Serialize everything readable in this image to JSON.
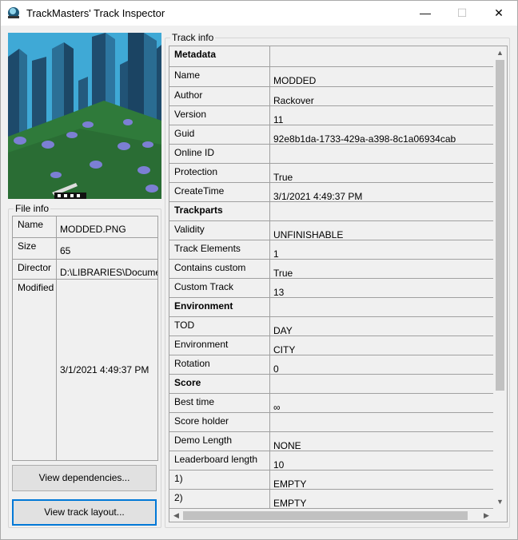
{
  "window": {
    "title": "TrackMasters' Track Inspector",
    "minimize_glyph": "—",
    "maximize_glyph": "☐",
    "close_glyph": "✕"
  },
  "file_info": {
    "label": "File info",
    "rows": [
      {
        "key": "Name",
        "value": "MODDED.PNG"
      },
      {
        "key": "Size",
        "value": "65"
      },
      {
        "key": "Director",
        "value": "D:\\LIBRARIES\\Documer"
      },
      {
        "key": "Modified",
        "value": "3/1/2021 4:49:37 PM"
      }
    ]
  },
  "buttons": {
    "dependencies": "View dependencies...",
    "layout": "View track layout..."
  },
  "track_info": {
    "label": "Track info",
    "rows": [
      {
        "key": "Metadata",
        "value": "",
        "section": true
      },
      {
        "key": "Name",
        "value": "MODDED"
      },
      {
        "key": "Author",
        "value": "Rackover"
      },
      {
        "key": "Version",
        "value": "11"
      },
      {
        "key": "Guid",
        "value": "92e8b1da-1733-429a-a398-8c1a06934cab"
      },
      {
        "key": "Online ID",
        "value": ""
      },
      {
        "key": "Protection",
        "value": "True"
      },
      {
        "key": "CreateTime",
        "value": "3/1/2021 4:49:37 PM"
      },
      {
        "key": "Trackparts",
        "value": "",
        "section": true
      },
      {
        "key": "Validity",
        "value": "UNFINISHABLE"
      },
      {
        "key": "Track Elements",
        "value": "1"
      },
      {
        "key": "Contains custom",
        "value": "True"
      },
      {
        "key": "Custom Track",
        "value": "13"
      },
      {
        "key": "Environment",
        "value": "",
        "section": true
      },
      {
        "key": "TOD",
        "value": "DAY"
      },
      {
        "key": "Environment",
        "value": "CITY"
      },
      {
        "key": "Rotation",
        "value": "0"
      },
      {
        "key": "Score",
        "value": "",
        "section": true
      },
      {
        "key": "Best time",
        "value": "∞"
      },
      {
        "key": "Score holder",
        "value": ""
      },
      {
        "key": "Demo Length",
        "value": "NONE"
      },
      {
        "key": "Leaderboard length",
        "value": "10"
      },
      {
        "key": "1)",
        "value": "EMPTY"
      },
      {
        "key": "2)",
        "value": "EMPTY"
      }
    ]
  },
  "scroll": {
    "up": "▲",
    "down": "▼",
    "left": "◀",
    "right": "▶"
  },
  "colors": {
    "accent": "#0078d7",
    "sky": "#3fa9d6",
    "grass": "#2f7a3a"
  }
}
